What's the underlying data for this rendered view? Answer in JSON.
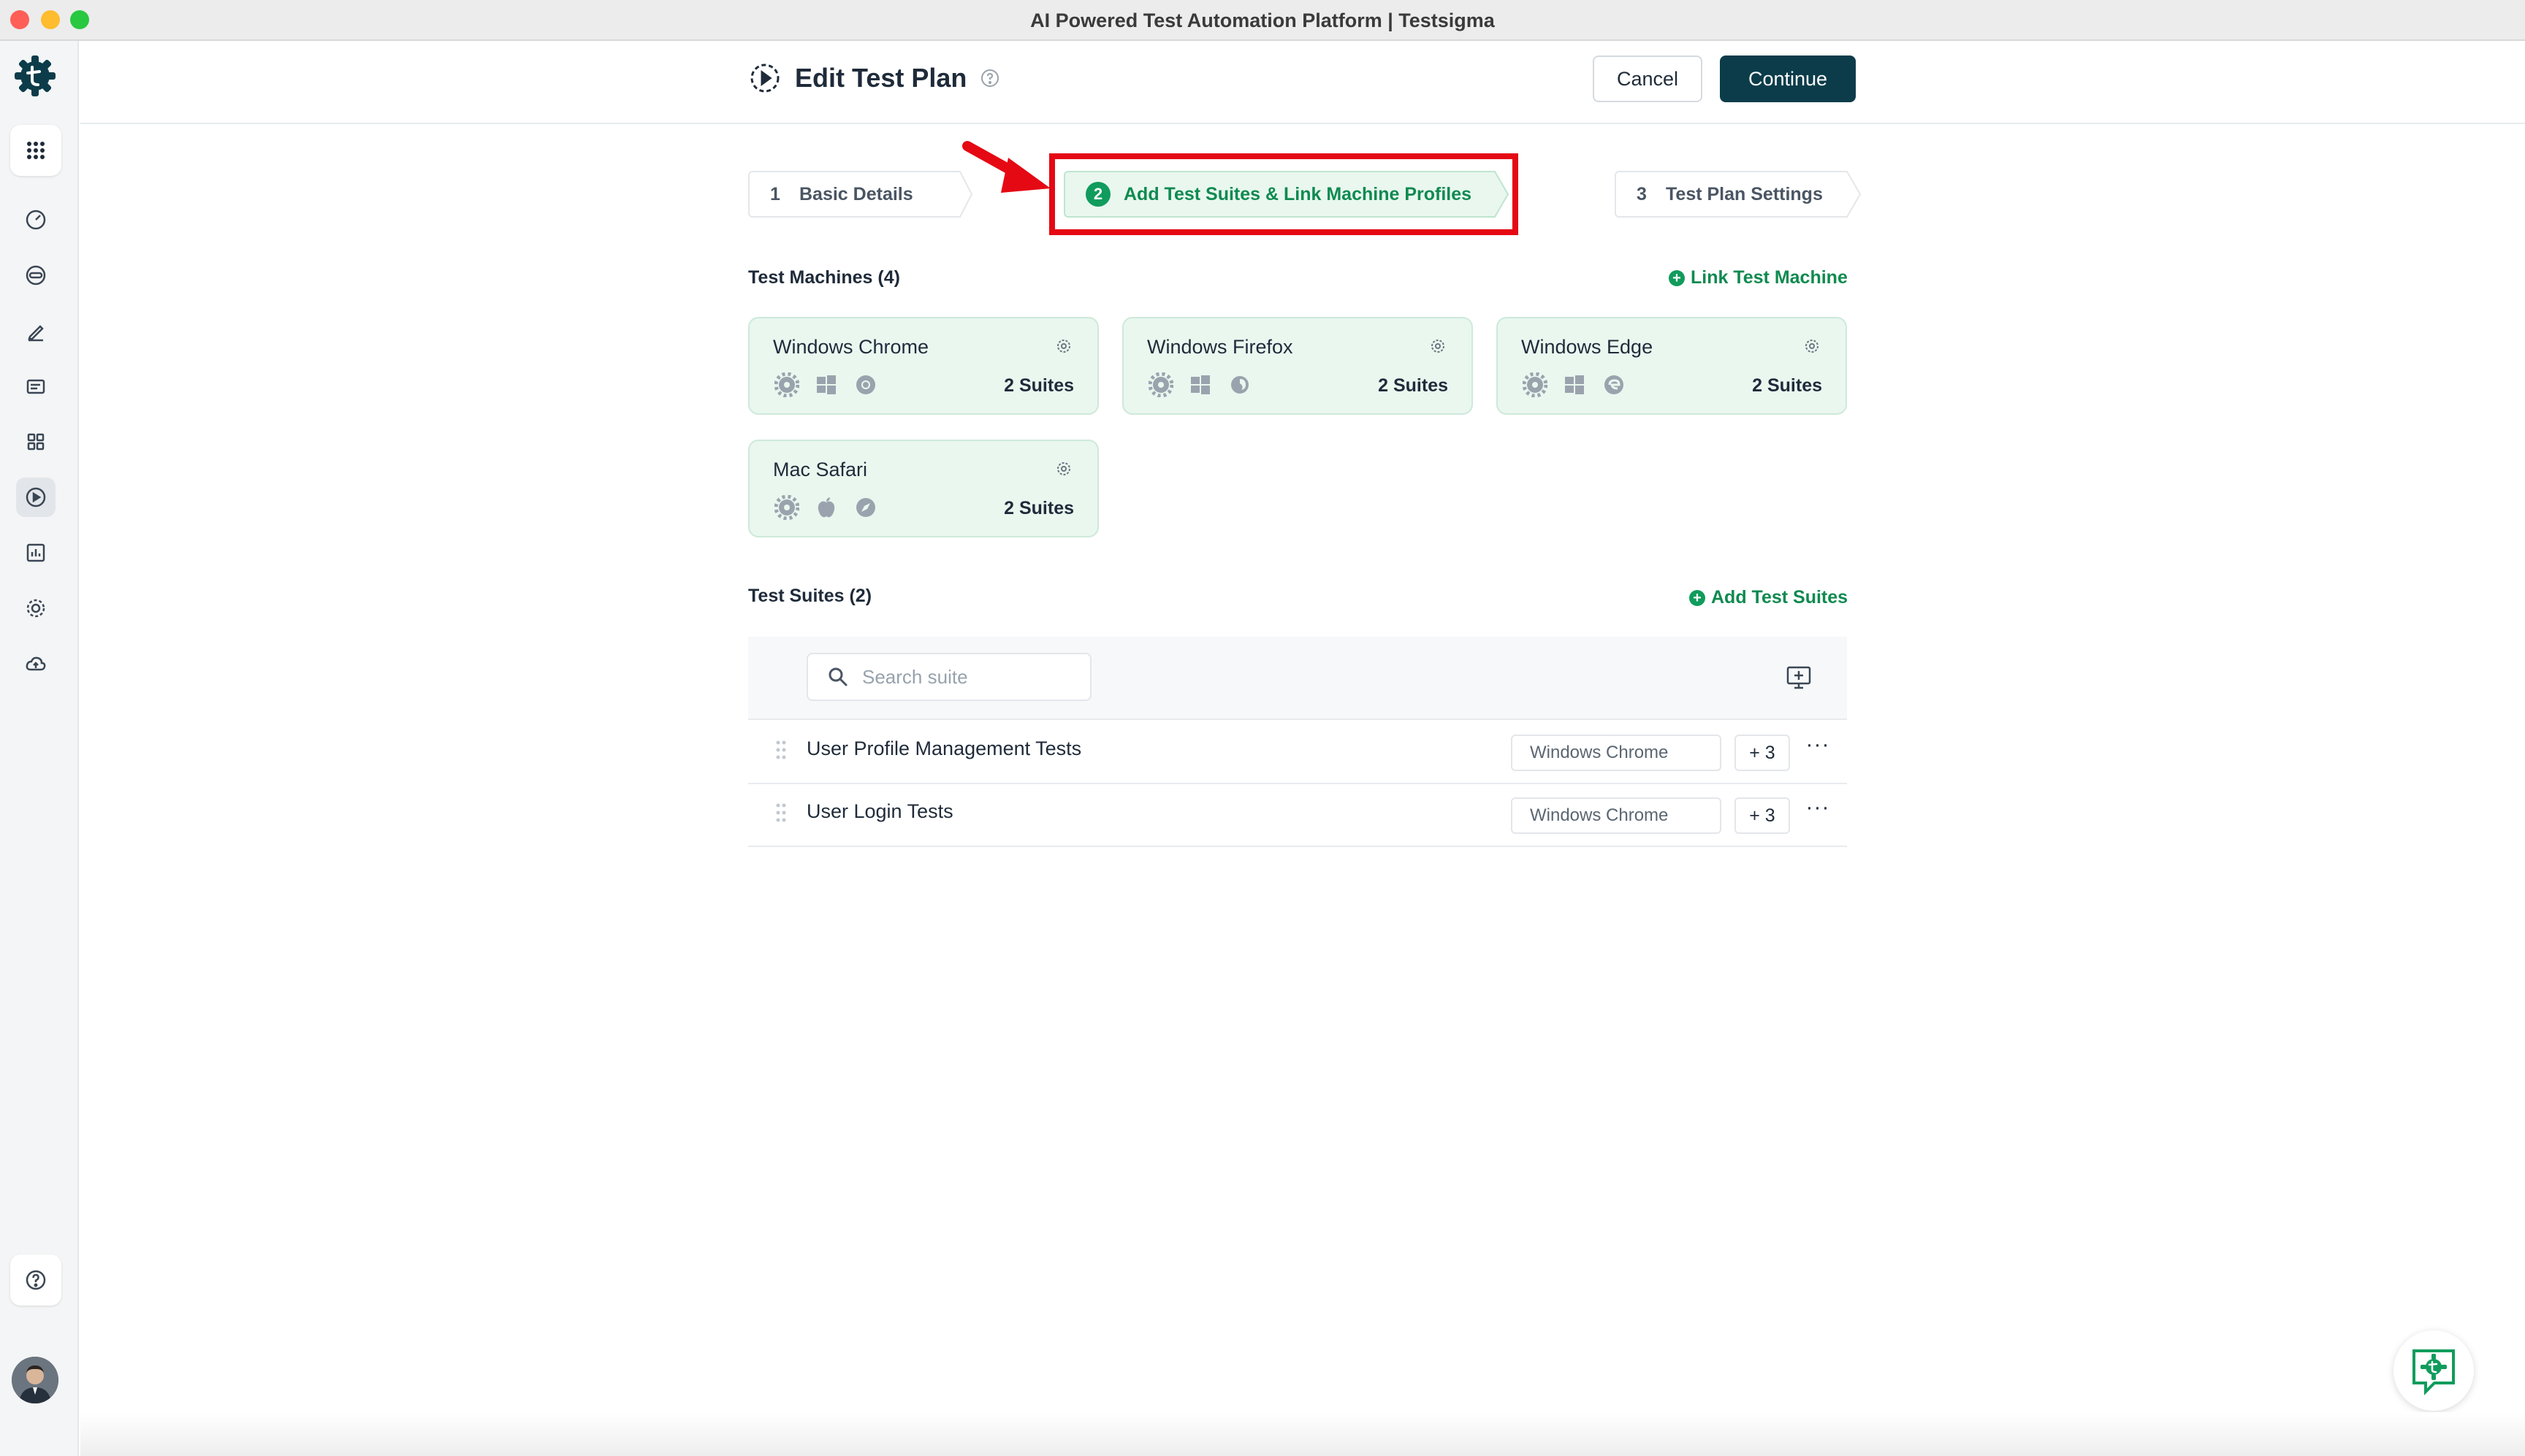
{
  "window": {
    "title": "AI Powered Test Automation Platform | Testsigma"
  },
  "header": {
    "title": "Edit Test Plan",
    "cancel_label": "Cancel",
    "continue_label": "Continue"
  },
  "steps": [
    {
      "number": "1",
      "label": "Basic Details"
    },
    {
      "number": "2",
      "label": "Add Test Suites & Link Machine Profiles"
    },
    {
      "number": "3",
      "label": "Test Plan Settings"
    }
  ],
  "machines_section": {
    "title": "Test Machines (4)",
    "link_label": "Link Test Machine",
    "machines": [
      {
        "name": "Windows Chrome",
        "suites": "2 Suites"
      },
      {
        "name": "Windows Firefox",
        "suites": "2 Suites"
      },
      {
        "name": "Windows Edge",
        "suites": "2 Suites"
      },
      {
        "name": "Mac Safari",
        "suites": "2 Suites"
      }
    ]
  },
  "suites_section": {
    "title": "Test Suites (2)",
    "add_label": "Add Test Suites",
    "search_placeholder": "Search suite",
    "rows": [
      {
        "name": "User Profile Management Tests",
        "machine": "Windows Chrome",
        "more": "+ 3"
      },
      {
        "name": "User Login Tests",
        "machine": "Windows Chrome",
        "more": "+ 3"
      }
    ]
  },
  "colors": {
    "accent": "#109c5c",
    "primary_button": "#0c3c4a",
    "card_bg": "#e9f7ef",
    "highlight": "#e50914"
  }
}
